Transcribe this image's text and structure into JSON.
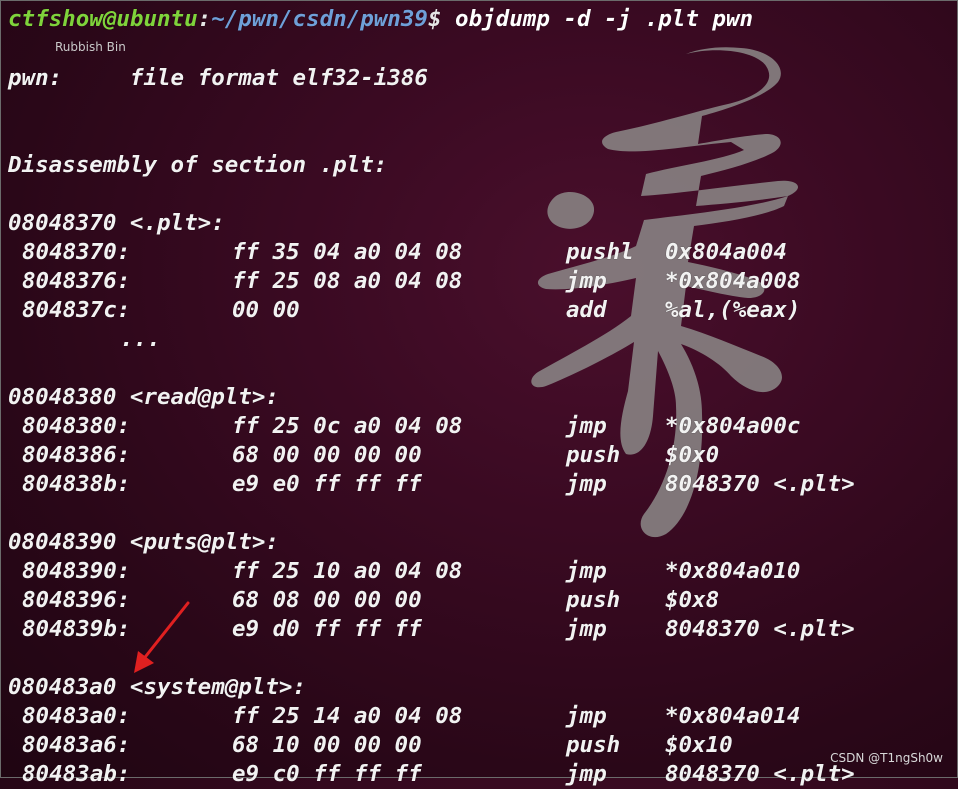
{
  "terminal": {
    "prompt": {
      "user_host": "ctfshow@ubuntu",
      "path": "~/pwn/csdn/pwn39",
      "symbol": "$",
      "command": " objdump -d -j .plt pwn"
    },
    "desktop_label": "Rubbish Bin",
    "file_line": "pwn:     file format elf32-i386",
    "section_line": "Disassembly of section .plt:",
    "blocks": [
      {
        "header": "08048370 <.plt>:",
        "rows": [
          {
            "addr": "8048370:",
            "bytes": "ff 35 04 a0 04 08",
            "op": "pushl",
            "arg": "0x804a004"
          },
          {
            "addr": "8048376:",
            "bytes": "ff 25 08 a0 04 08",
            "op": "jmp",
            "arg": "*0x804a008"
          },
          {
            "addr": "804837c:",
            "bytes": "00 00",
            "op": "add",
            "arg": "%al,(%eax)"
          }
        ],
        "ellipsis": "..."
      },
      {
        "header": "08048380 <read@plt>:",
        "rows": [
          {
            "addr": "8048380:",
            "bytes": "ff 25 0c a0 04 08",
            "op": "jmp",
            "arg": "*0x804a00c"
          },
          {
            "addr": "8048386:",
            "bytes": "68 00 00 00 00",
            "op": "push",
            "arg": "$0x0"
          },
          {
            "addr": "804838b:",
            "bytes": "e9 e0 ff ff ff",
            "op": "jmp",
            "arg": "8048370 <.plt>"
          }
        ]
      },
      {
        "header": "08048390 <puts@plt>:",
        "rows": [
          {
            "addr": "8048390:",
            "bytes": "ff 25 10 a0 04 08",
            "op": "jmp",
            "arg": "*0x804a010"
          },
          {
            "addr": "8048396:",
            "bytes": "68 08 00 00 00",
            "op": "push",
            "arg": "$0x8"
          },
          {
            "addr": "804839b:",
            "bytes": "e9 d0 ff ff ff",
            "op": "jmp",
            "arg": "8048370 <.plt>"
          }
        ]
      },
      {
        "header": "080483a0 <system@plt>:",
        "rows": [
          {
            "addr": "80483a0:",
            "bytes": "ff 25 14 a0 04 08",
            "op": "jmp",
            "arg": "*0x804a014"
          },
          {
            "addr": "80483a6:",
            "bytes": "68 10 00 00 00",
            "op": "push",
            "arg": "$0x10"
          },
          {
            "addr": "80483ab:",
            "bytes": "e9 c0 ff ff ff",
            "op": "jmp",
            "arg": "8048370 <.plt>"
          }
        ]
      }
    ]
  },
  "watermark": "CSDN @T1ngSh0w",
  "colors": {
    "prompt_user": "#7fd33b",
    "prompt_path": "#6f9fd8",
    "annotation_arrow": "#e02020",
    "background": "#3a0a22"
  }
}
